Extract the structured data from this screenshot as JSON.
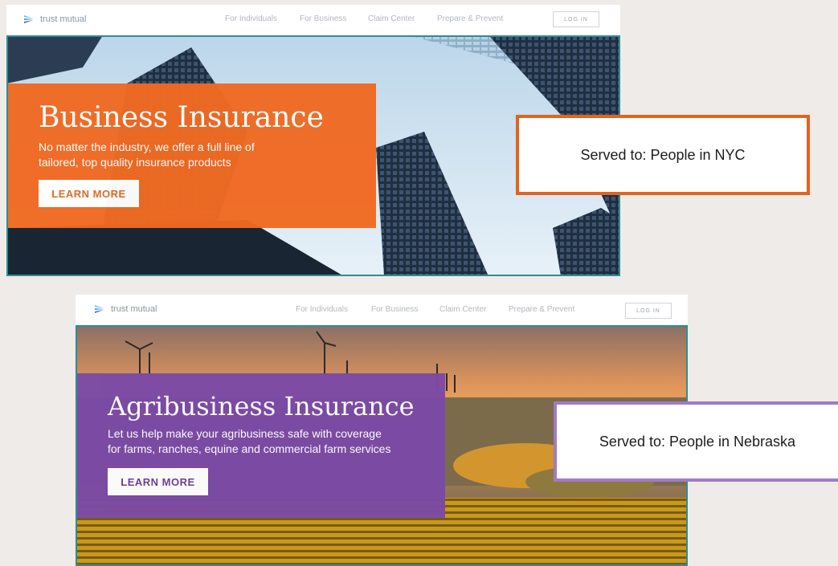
{
  "sites": [
    {
      "logo_text": "trust mutual",
      "nav": [
        "For Individuals",
        "For Business",
        "Claim Center",
        "Prepare & Prevent"
      ],
      "login_label": "LOG IN",
      "hero": {
        "title": "Business Insurance",
        "subtitle_line1": "No matter the industry, we offer a full line of",
        "subtitle_line2": "tailored, top quality insurance products",
        "cta_label": "LEARN MORE"
      },
      "callout": "Served to: People in NYC",
      "accent": "#f06a22"
    },
    {
      "logo_text": "trust mutual",
      "nav": [
        "For Individuals",
        "For Business",
        "Claim Center",
        "Prepare & Prevent"
      ],
      "login_label": "LOG IN",
      "hero": {
        "title": "Agribusiness Insurance",
        "subtitle_line1": "Let us help make your agribusiness safe with coverage",
        "subtitle_line2": "for farms, ranches, equine and commercial farm services",
        "cta_label": "LEARN MORE"
      },
      "callout": "Served to: People in Nebraska",
      "accent": "#7b4aa6"
    }
  ]
}
